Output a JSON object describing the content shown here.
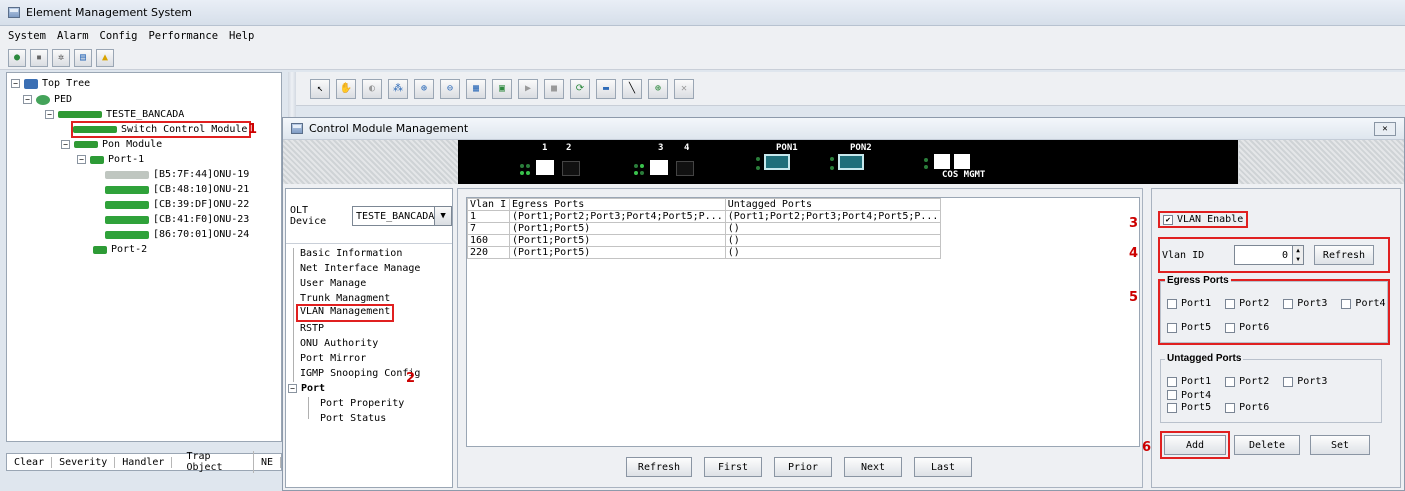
{
  "app": {
    "title": "Element Management System",
    "menu": [
      "System",
      "Alarm",
      "Config",
      "Performance",
      "Help"
    ]
  },
  "tree": {
    "root": "Top Tree",
    "device": "PED",
    "site": "TESTE_BANCADA",
    "switch_module": "Switch Control Module",
    "pon_module": "Pon Module",
    "port1": "Port-1",
    "onus": [
      "[B5:7F:44]ONU-19",
      "[CB:48:10]ONU-21",
      "[CB:39:DF]ONU-22",
      "[CB:41:F0]ONU-23",
      "[86:70:01]ONU-24"
    ],
    "port2": "Port-2"
  },
  "alarm_columns": [
    "Clear",
    "Severity",
    "Handler",
    "Trap Object",
    "NE"
  ],
  "annotations": [
    "1",
    "2",
    "3",
    "4",
    "5",
    "6"
  ],
  "dialog": {
    "title": "Control Module Management",
    "close_label": "✕",
    "panel_labels": [
      "1",
      "2",
      "3",
      "4",
      "PON1",
      "PON2",
      "COS MGMT"
    ],
    "olt_label": "OLT Device",
    "olt_value": "TESTE_BANCADA",
    "nav_items": [
      "Basic Information",
      "Net Interface Manage",
      "User Manage",
      "Trunk Managment",
      "VLAN Management",
      "RSTP",
      "ONU Authority",
      "Port Mirror",
      "IGMP Snooping Config"
    ],
    "nav_port_group": "Port",
    "nav_port_items": [
      "Port Properity",
      "Port Status"
    ],
    "table_headers": [
      "Vlan I",
      "Egress Ports",
      "Untagged Ports"
    ],
    "table_rows": [
      [
        "1",
        "(Port1;Port2;Port3;Port4;Port5;P...",
        "(Port1;Port2;Port3;Port4;Port5;P..."
      ],
      [
        "7",
        "(Port1;Port5)",
        "()"
      ],
      [
        "160",
        "(Port1;Port5)",
        "()"
      ],
      [
        "220",
        "(Port1;Port5)",
        "()"
      ]
    ],
    "table_buttons": [
      "Refresh",
      "First",
      "Prior",
      "Next",
      "Last"
    ],
    "vlan_enable": "VLAN Enable",
    "vlan_id_label": "Vlan ID",
    "vlan_id_value": "0",
    "refresh_label": "Refresh",
    "egress_title": "Egress Ports",
    "untagged_title": "Untagged Ports",
    "ports": [
      "Port1",
      "Port2",
      "Port3",
      "Port4",
      "Port5",
      "Port6"
    ],
    "action_buttons": [
      "Add",
      "Delete",
      "Set"
    ]
  }
}
